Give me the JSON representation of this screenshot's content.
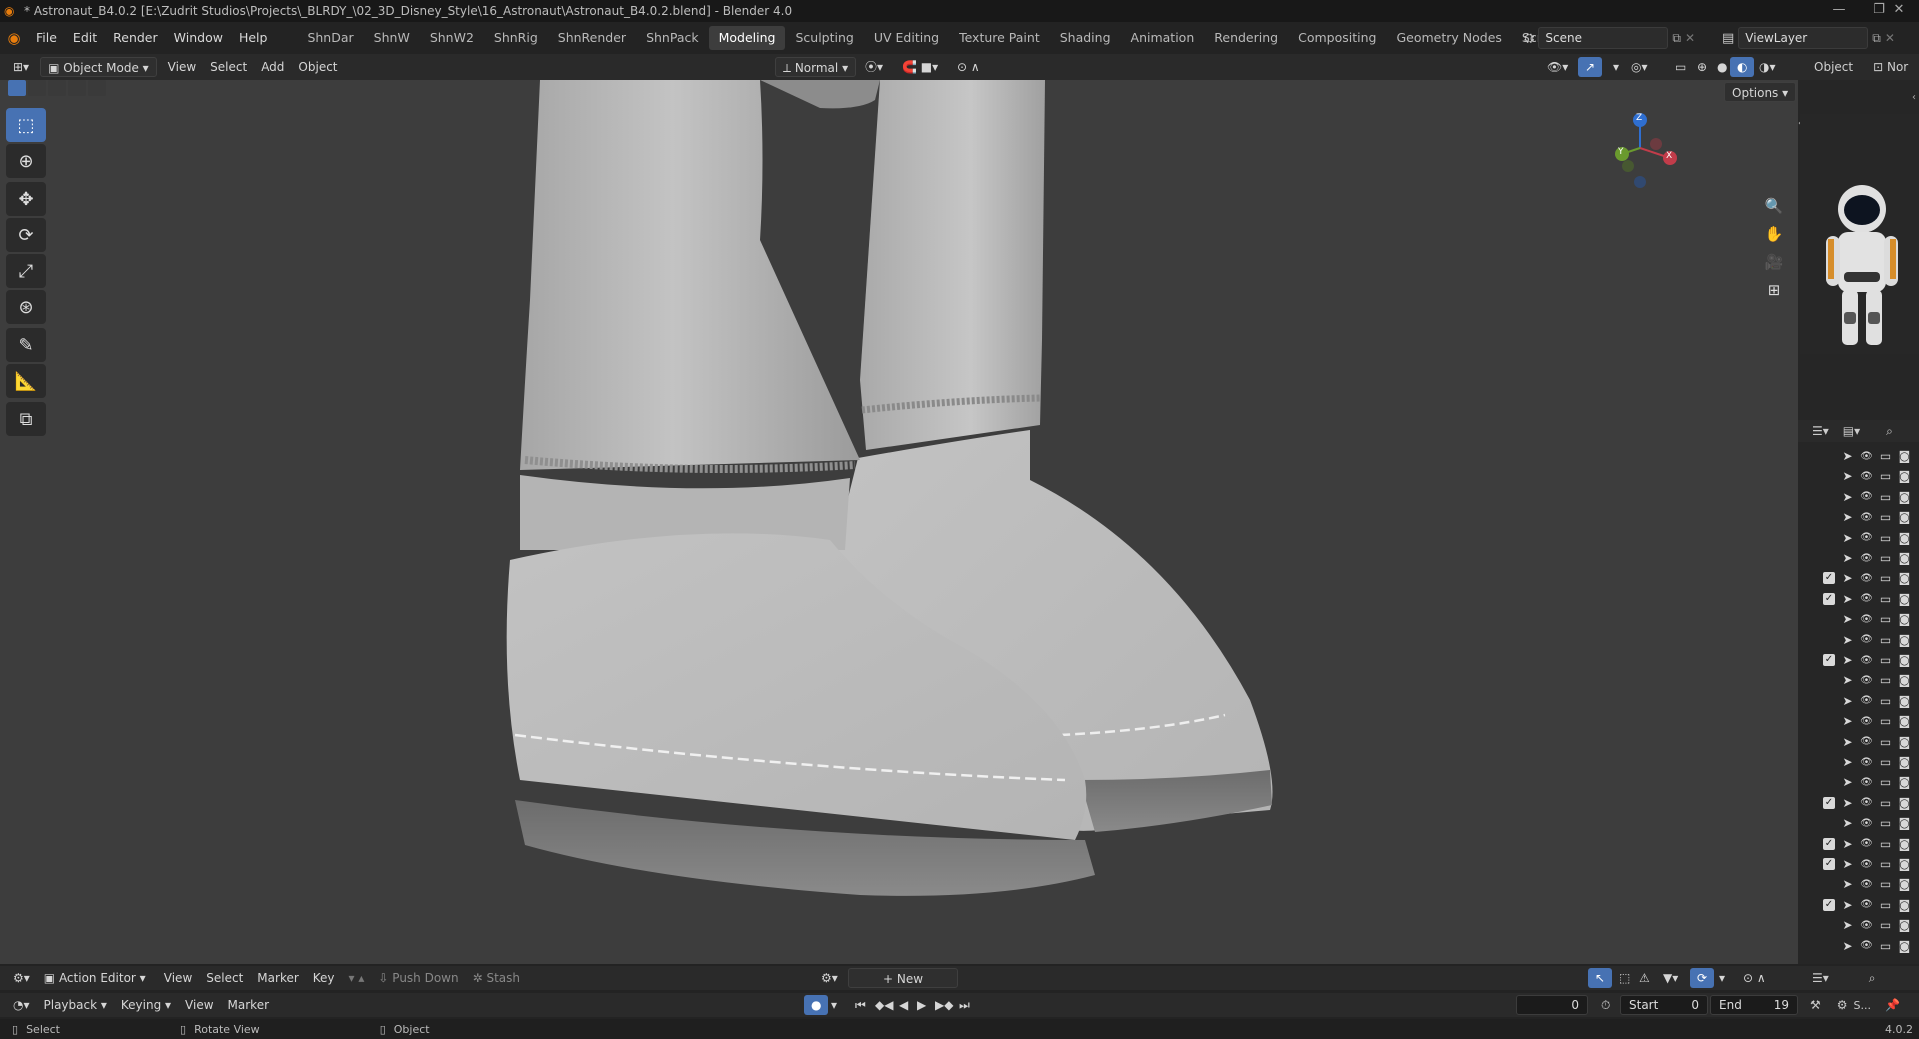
{
  "window": {
    "title": "* Astronaut_B4.0.2 [E:\\Zudrit Studios\\Projects\\_BLRDY_\\02_3D_Disney_Style\\16_Astronaut\\Astronaut_B4.0.2.blend] - Blender 4.0",
    "minimize": "—",
    "maximize": "❐",
    "close": "✕"
  },
  "menu": [
    "File",
    "Edit",
    "Render",
    "Window",
    "Help"
  ],
  "workspaces": [
    "ShnDar",
    "ShnW",
    "ShnW2",
    "ShnRig",
    "ShnRender",
    "ShnPack",
    "Modeling",
    "Sculpting",
    "UV Editing",
    "Texture Paint",
    "Shading",
    "Animation",
    "Rendering",
    "Compositing",
    "Geometry Nodes",
    "Scripting",
    "+"
  ],
  "active_workspace": "Modeling",
  "scene": {
    "label": "Scene",
    "view_layer": "ViewLayer"
  },
  "viewport_header": {
    "mode": "Object Mode",
    "menus": [
      "View",
      "Select",
      "Add",
      "Object"
    ],
    "orientation": "Normal",
    "options": "Options"
  },
  "tools": [
    "select-box",
    "cursor",
    "move",
    "rotate",
    "scale",
    "transform",
    "annotate",
    "measure",
    "add-cube"
  ],
  "gizmo": {
    "x": "X",
    "y": "Y",
    "z": "Z"
  },
  "properties_tabs": {
    "object": "Object",
    "normal": "Nor"
  },
  "outliner_rows": [
    {
      "checked": false
    },
    {
      "checked": false
    },
    {
      "checked": false
    },
    {
      "checked": false
    },
    {
      "checked": false
    },
    {
      "checked": false
    },
    {
      "checked": true
    },
    {
      "checked": true
    },
    {
      "checked": false
    },
    {
      "checked": false
    },
    {
      "checked": true
    },
    {
      "checked": false
    },
    {
      "checked": false
    },
    {
      "checked": false
    },
    {
      "checked": false
    },
    {
      "checked": false
    },
    {
      "checked": false
    },
    {
      "checked": true
    },
    {
      "checked": false
    },
    {
      "checked": true
    },
    {
      "checked": true
    },
    {
      "checked": false
    },
    {
      "checked": true
    },
    {
      "checked": false
    },
    {
      "checked": false
    }
  ],
  "action_editor": {
    "label": "Action Editor",
    "menus": [
      "View",
      "Select",
      "Marker",
      "Key"
    ],
    "push_down": "Push Down",
    "stash": "Stash",
    "new": "New"
  },
  "timeline": {
    "menus": [
      "Playback",
      "Keying",
      "View",
      "Marker"
    ],
    "current_frame": "0",
    "start_label": "Start",
    "start": "0",
    "end_label": "End",
    "end": "19",
    "scene_short": "S..."
  },
  "status": {
    "select": "Select",
    "rotate": "Rotate View",
    "object": "Object",
    "version": "4.0.2"
  },
  "colors": {
    "accent": "#4772b3",
    "active_ws": "#3d3d3d",
    "viewport": "#3d3d3d"
  }
}
